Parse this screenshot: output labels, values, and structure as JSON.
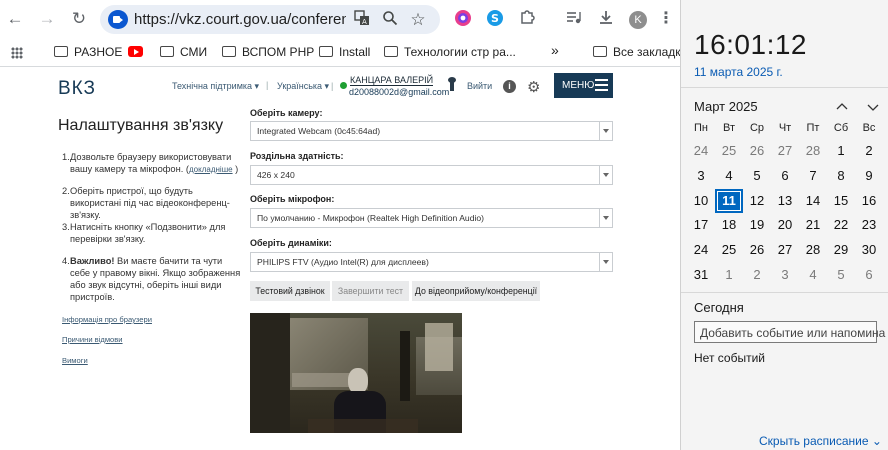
{
  "browser": {
    "url": "https://vkz.court.gov.ua/conference/...",
    "profile_initial": "K",
    "bookmarks": [
      "РАЗНОЕ",
      "СМИ",
      "ВСПОМ РНР",
      "Install",
      "Технологии стр ра...",
      "Все закладки"
    ],
    "more": "»"
  },
  "site": {
    "logo": "ВКЗ",
    "support": "Технічна підтримка ▾",
    "language": "Українська ▾",
    "separator": "|",
    "user_name": "КАНЦАРА ВАЛЕРІЙ",
    "user_email": "d20088002d@gmail.com",
    "logout": "Вийти",
    "menu": "МЕНЮ",
    "info": "i"
  },
  "settings": {
    "title": "Налаштування зв'язку",
    "steps": [
      {
        "num": "1.",
        "text": "Дозвольте браузеру використовувати вашу камеру та мікрофон. (",
        "link": "докладніше",
        "tail": " )"
      },
      {
        "num": "2.",
        "text": "Оберіть пристрої, що будуть використані під час відеоконференц-зв'язку."
      },
      {
        "num": "3.",
        "text": "Натисніть кнопку «Подзвонити» для перевірки зв'язку."
      },
      {
        "num": "4.",
        "bold": "Важливо!",
        "text": " Ви маєте бачити та чути себе у правому вікні. Якщо зображення або звук відсутні, оберіть інші види пристроїв."
      }
    ],
    "links": [
      "Інформація про браузери",
      "Причини відмови",
      "Вимоги"
    ],
    "camera_label": "Оберіть камеру:",
    "camera_value": "Integrated Webcam (0c45:64ad)",
    "resolution_label": "Роздільна здатність:",
    "resolution_value": "426 x 240",
    "mic_label": "Оберіть мікрофон:",
    "mic_value": "По умолчанию - Микрофон (Realtek High Definition Audio)",
    "speaker_label": "Оберіть динаміки:",
    "speaker_value": "PHILIPS FTV (Аудио Intel(R) для дисплеев)",
    "btn_test": "Тестовий дзвінок",
    "btn_finish": "Завершити тест",
    "btn_join": "До відеоприйому/конференції"
  },
  "calendar": {
    "time": "16:01:12",
    "date": "11 марта 2025 г.",
    "month": "Март 2025",
    "weekdays": [
      "Пн",
      "Вт",
      "Ср",
      "Чт",
      "Пт",
      "Сб",
      "Вс"
    ],
    "weeks": [
      [
        "24",
        "25",
        "26",
        "27",
        "28",
        "1",
        "2"
      ],
      [
        "3",
        "4",
        "5",
        "6",
        "7",
        "8",
        "9"
      ],
      [
        "10",
        "11",
        "12",
        "13",
        "14",
        "15",
        "16"
      ],
      [
        "17",
        "18",
        "19",
        "20",
        "21",
        "22",
        "23"
      ],
      [
        "24",
        "25",
        "26",
        "27",
        "28",
        "29",
        "30"
      ],
      [
        "31",
        "1",
        "2",
        "3",
        "4",
        "5",
        "6"
      ]
    ],
    "today_label": "Сегодня",
    "event_placeholder": "Добавить событие или напомина",
    "no_events": "Нет событий",
    "schedule": "Скрыть расписание ⌄"
  }
}
